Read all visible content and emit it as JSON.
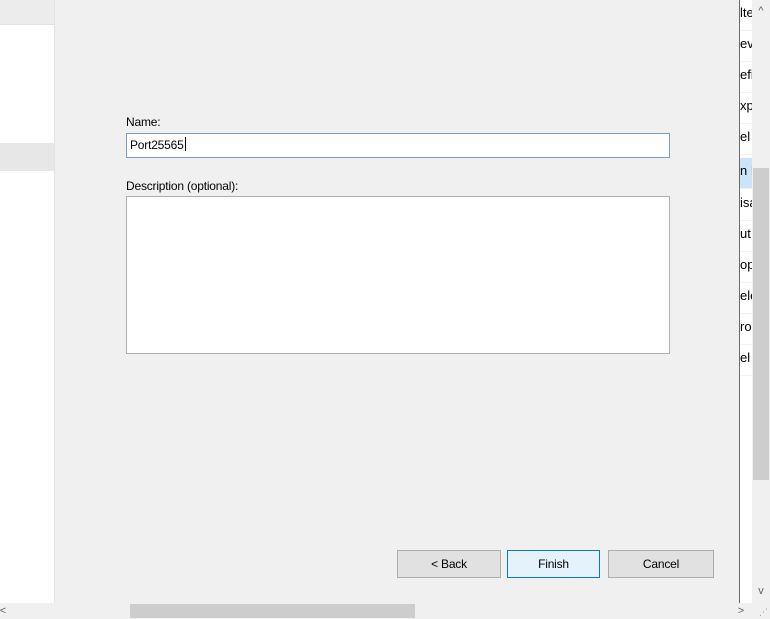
{
  "form": {
    "name_label": "Name:",
    "name_value": "Port25565",
    "description_label": "Description (optional):",
    "description_value": ""
  },
  "buttons": {
    "back": "< Back",
    "finish": "Finish",
    "cancel": "Cancel"
  },
  "right_list": {
    "items": [
      "lte",
      "ev",
      "efi",
      "xp",
      "el",
      "n F",
      "isa",
      "ut",
      "op",
      "ele",
      "ro",
      "el"
    ],
    "selected_index": 5
  },
  "scroll": {
    "up_arrow": "^",
    "down_arrow": "v",
    "left_arrow": "<",
    "right_arrow": ">"
  },
  "icons": [
    "scroll-up-icon",
    "scroll-down-icon",
    "scroll-left-icon",
    "scroll-right-icon",
    "resize-grip-icon"
  ]
}
